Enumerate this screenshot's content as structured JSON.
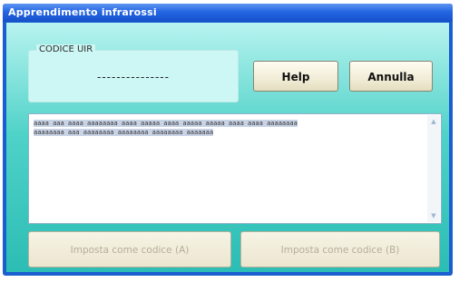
{
  "window": {
    "title": "Apprendimento infrarossi"
  },
  "code_group": {
    "legend": "CODICE UIR",
    "value": "---------------"
  },
  "buttons": {
    "help": "Help",
    "annulla": "Annulla",
    "set_a": "Imposta come codice (A)",
    "set_b": "Imposta come codice (B)"
  },
  "code_text": {
    "line1": "aaaa aaa aaaa aaaaaaaa aaaa aaaaa aaaa aaaaa aaaaa aaaa aaaa aaaaaaaa",
    "line2": "aaaaaaaa aaa aaaaaaaa aaaaaaaa aaaaaaaa aaaaaaa"
  },
  "colors": {
    "title_bar": "#2566e3",
    "client_top": "#b8f3f0",
    "client_bottom": "#2cbdb4"
  }
}
